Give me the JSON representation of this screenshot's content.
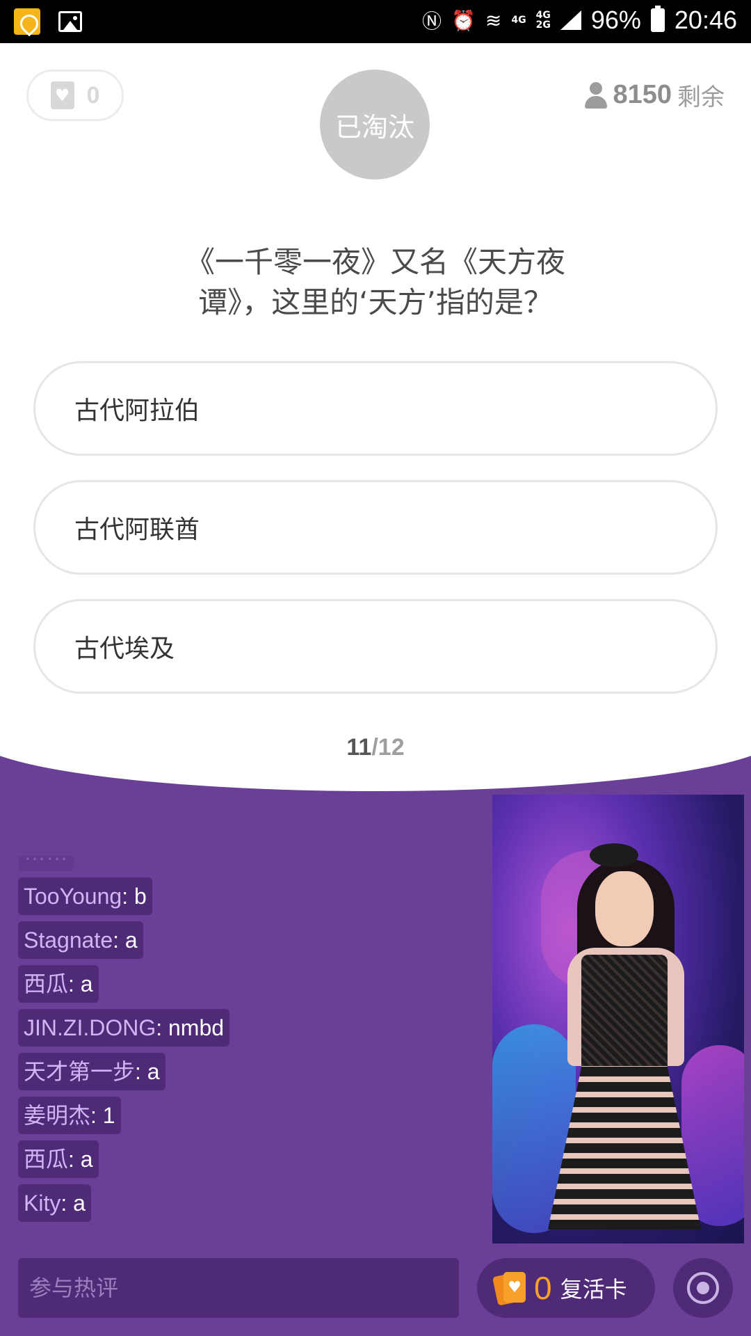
{
  "status_bar": {
    "network_small_1": "4G",
    "network_small_2a": "4G",
    "network_small_2b": "2G",
    "battery": "96%",
    "time": "20:46"
  },
  "header": {
    "lives": "0",
    "eliminated_label": "已淘汰",
    "remaining_count": "8150",
    "remaining_label": "剩余"
  },
  "question": {
    "text": "《一千零一夜》又名《天方夜谭》，这里的‘天方’指的是？",
    "options": [
      {
        "label": "古代阿拉伯"
      },
      {
        "label": "古代阿联酋"
      },
      {
        "label": "古代埃及"
      }
    ],
    "progress_current": "11",
    "progress_total": "/12"
  },
  "comments": [
    {
      "user": "TooYoung",
      "msg": ": b"
    },
    {
      "user": "Stagnate",
      "msg": ": a"
    },
    {
      "user": "西瓜",
      "msg": ": a"
    },
    {
      "user": "JIN.ZI.DONG",
      "msg": ": nmbd"
    },
    {
      "user": "天才第一步",
      "msg": ": a"
    },
    {
      "user": "姜明杰",
      "msg": ": 1"
    },
    {
      "user": "西瓜",
      "msg": ": a"
    },
    {
      "user": "Kity",
      "msg": ": a"
    }
  ],
  "bottom": {
    "comment_placeholder": "参与热评",
    "revive_count": "0",
    "revive_label": "复活卡"
  },
  "colors": {
    "background_purple": "#6a3f97",
    "chip_purple": "#4f2a76",
    "accent_orange": "#f7a02a"
  }
}
